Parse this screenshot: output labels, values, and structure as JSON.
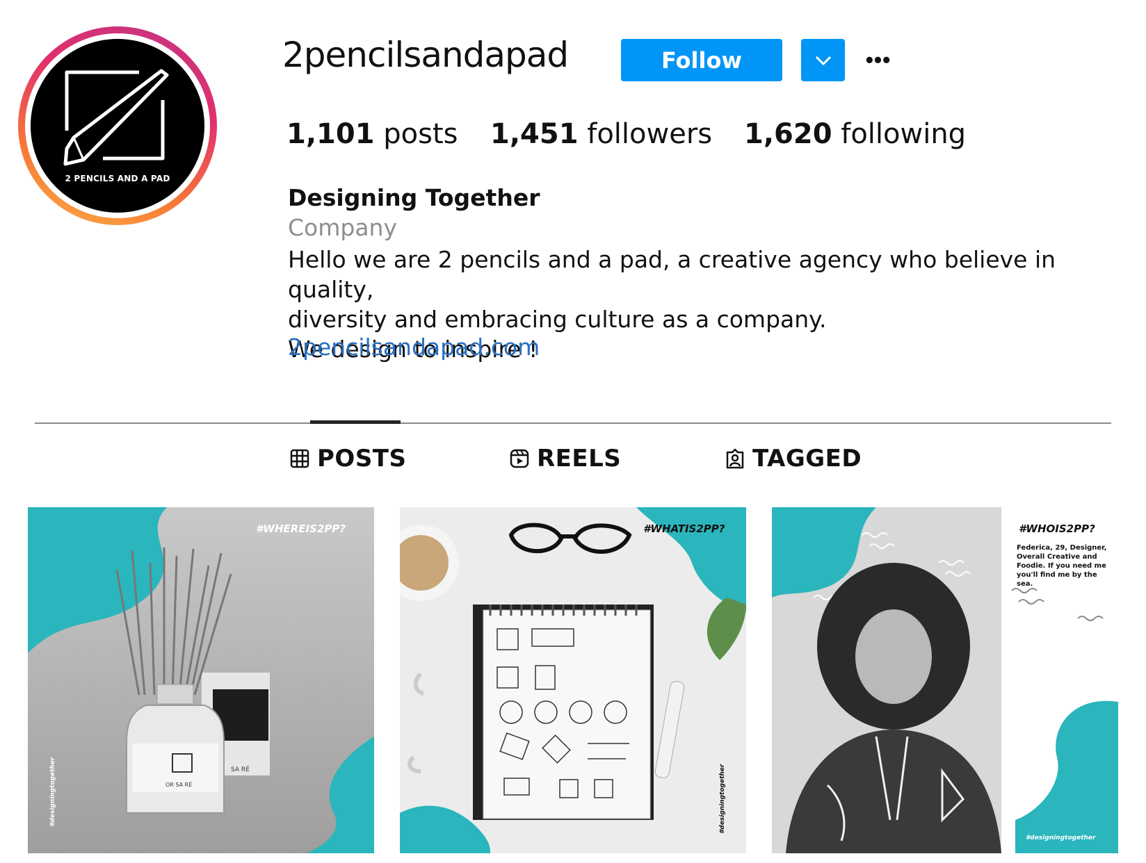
{
  "profile": {
    "avatar_text": "2 PENCILS AND A PAD",
    "username": "2pencilsandapad",
    "follow_label": "Follow",
    "more_glyph": "•••",
    "stats": {
      "posts_count": "1,101",
      "posts_label": "posts",
      "followers_count": "1,451",
      "followers_label": "followers",
      "following_count": "1,620",
      "following_label": "following"
    },
    "bio": {
      "name": "Designing Together",
      "category": "Company",
      "line1": "Hello we are 2 pencils and a pad, a creative agency who believe in quality,",
      "line2": "diversity and embracing culture as a company.",
      "line3": "We design to inspire !",
      "link": "2pencilsandapad.com"
    }
  },
  "tabs": [
    {
      "label": "POSTS",
      "icon": "grid-icon",
      "active": true
    },
    {
      "label": "REELS",
      "icon": "reels-icon",
      "active": false
    },
    {
      "label": "TAGGED",
      "icon": "tagged-icon",
      "active": false
    }
  ],
  "posts": [
    {
      "hashtag": "#WHEREIS2PP?",
      "side_tag": "#designingtogether",
      "label_text": "OR SA RÉ",
      "box_text": "SA RÉ"
    },
    {
      "hashtag": "#WHATIS2PP?",
      "side_tag": "#designingtogether"
    },
    {
      "hashtag": "#WHOIS2PP?",
      "caption": "Federica, 29, Designer, Overall Creative and Foodie. If you need me you'll find me by the sea.",
      "side_tag": "#designingtogether"
    }
  ],
  "colors": {
    "accent": "#0095f6",
    "teal": "#2bb5bc",
    "link": "#2a6fc1"
  }
}
